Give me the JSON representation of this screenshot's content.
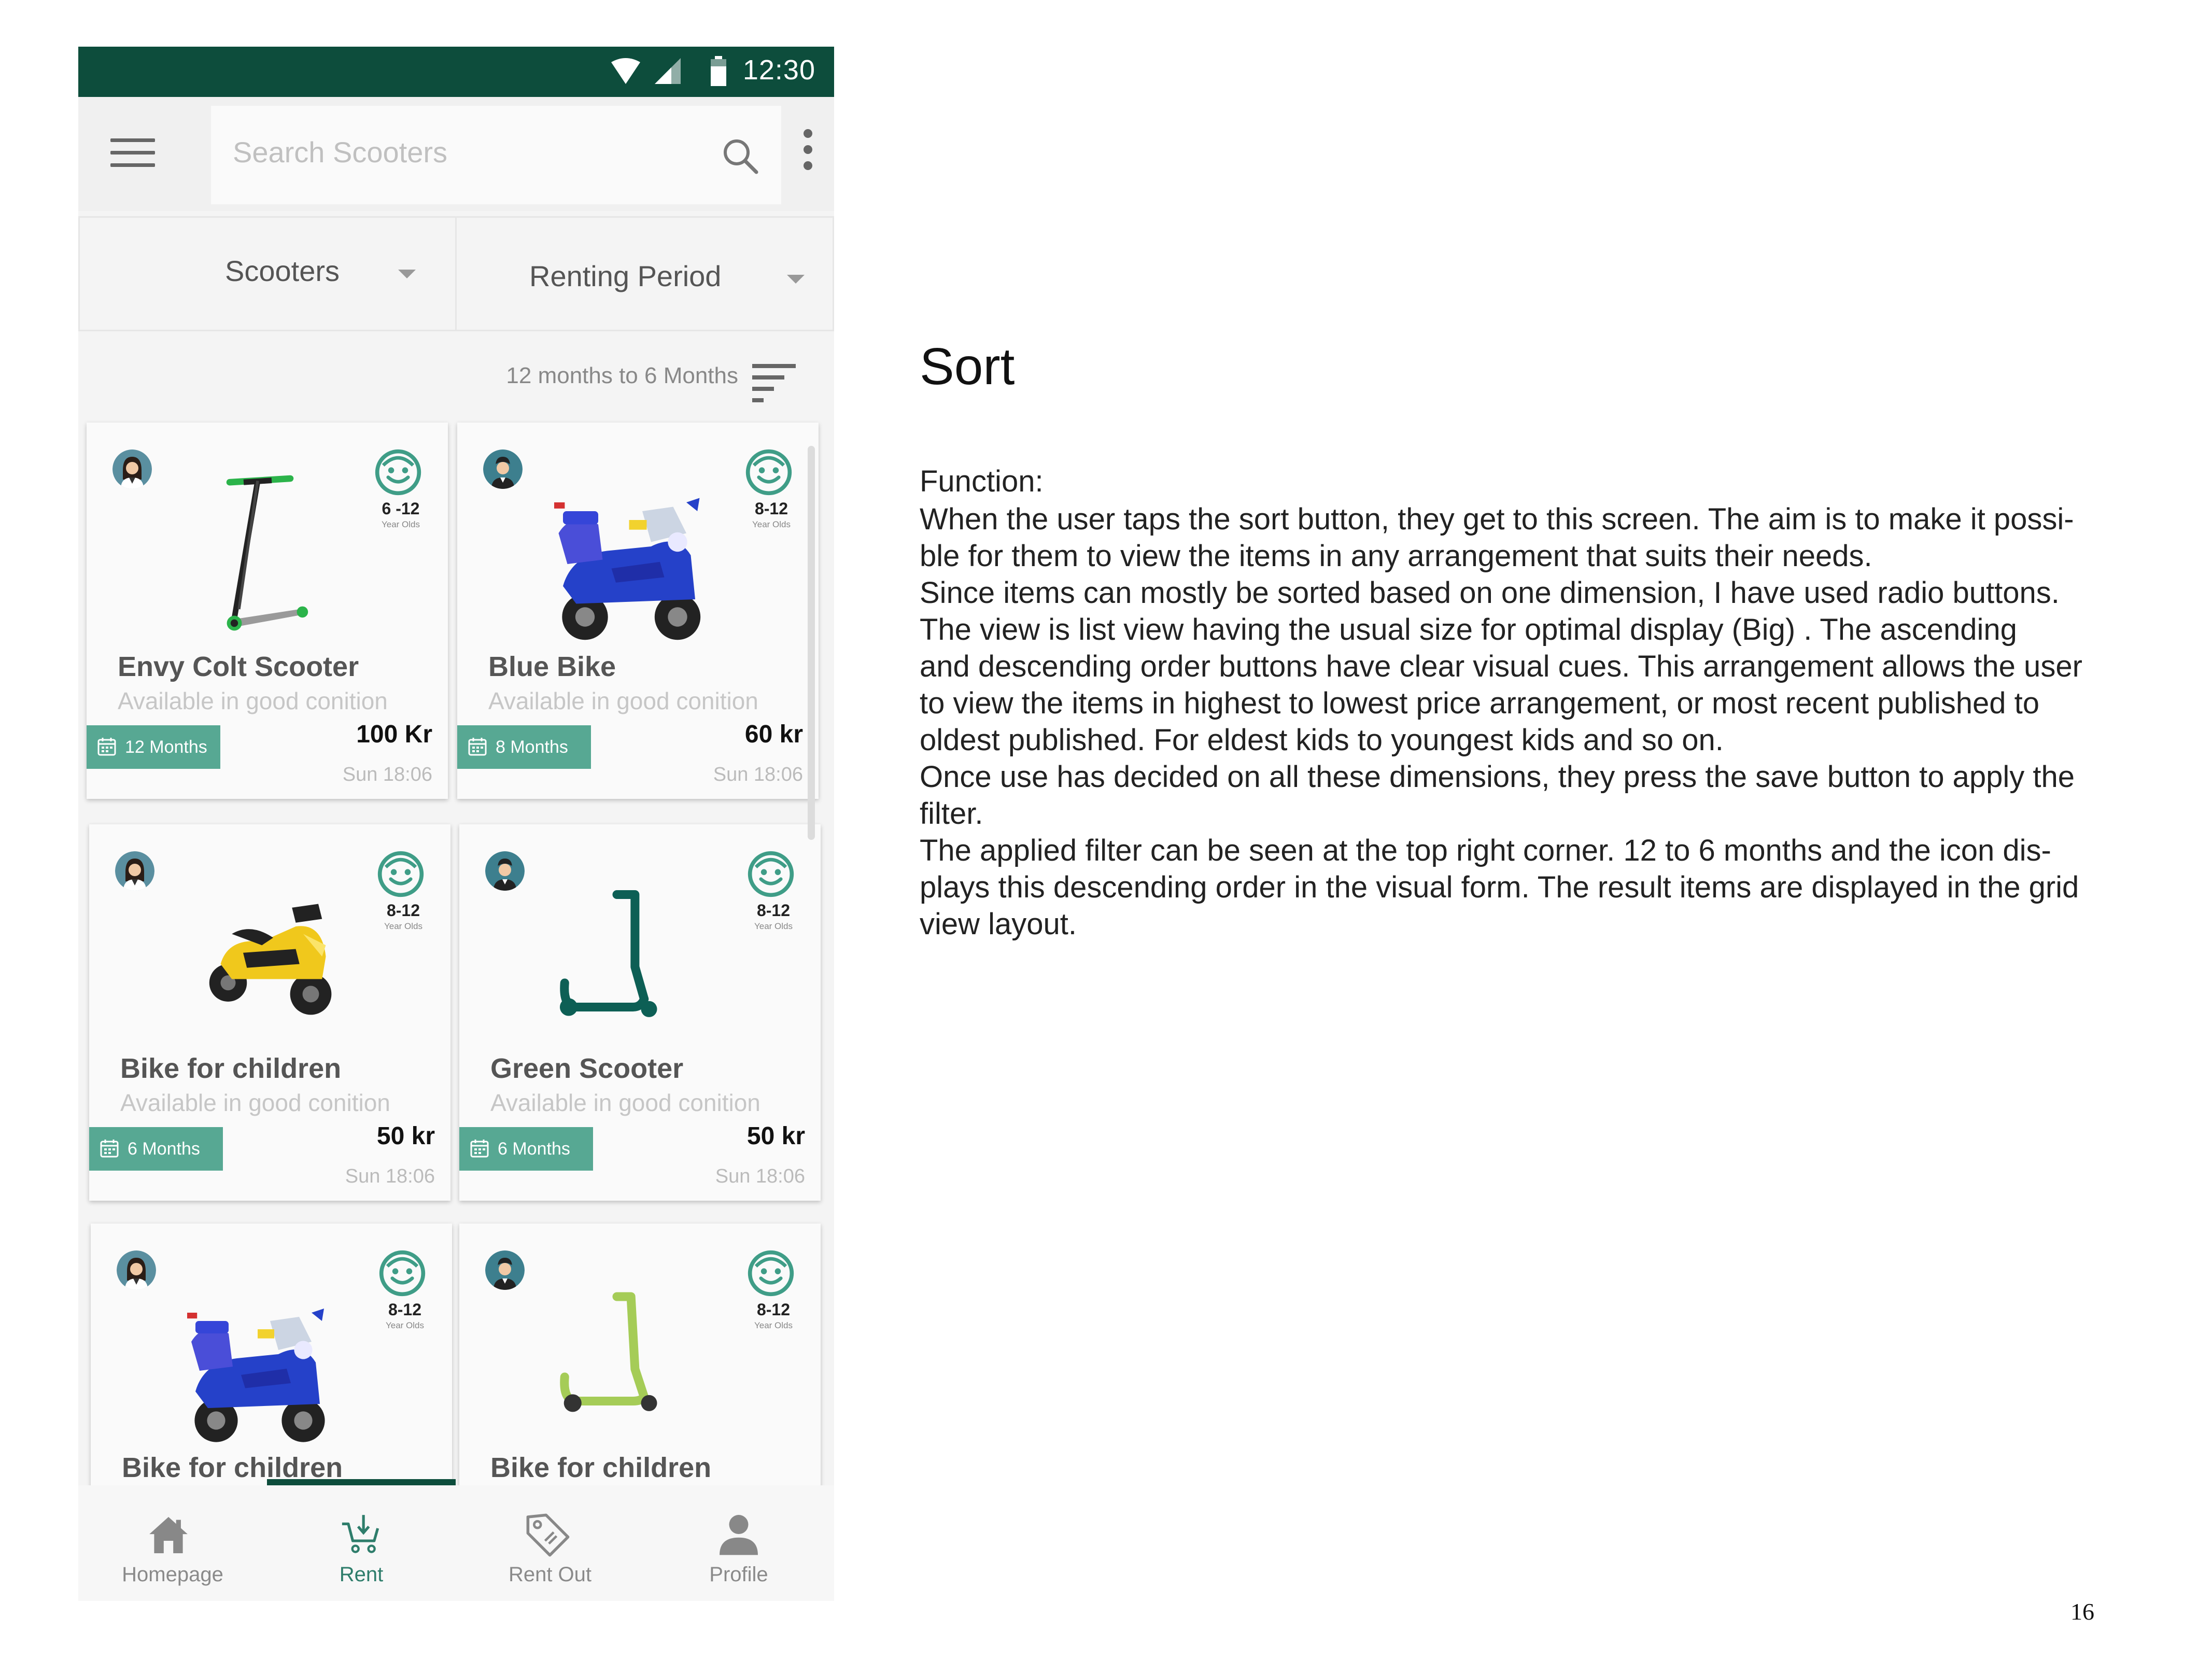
{
  "app": {
    "statusbar": {
      "time": "12:30",
      "wifi_icon": "wifi-icon",
      "signal_icon": "signal-icon",
      "battery_icon": "battery-icon"
    },
    "search": {
      "placeholder": "Search Scooters",
      "value": ""
    },
    "filters": {
      "category": "Scooters",
      "period": "Renting Period"
    },
    "sort": {
      "label": "12 months to 6 Months",
      "icon": "sort-descending-icon"
    },
    "colors": {
      "brand_dark": "#0d4d3c",
      "accent": "#57a893",
      "nav_active": "#2e7d6b"
    },
    "items": [
      {
        "title": "Envy Colt Scooter",
        "desc": "Available in good conition",
        "period": "12 Months",
        "price": "100 Kr",
        "when": "Sun 18:06",
        "age_range": "6 -12",
        "age_sub": "Year Olds",
        "image": "kick-scooter-image"
      },
      {
        "title": "Blue Bike",
        "desc": "Available in good conition",
        "period": "8 Months",
        "price": "60 kr",
        "when": "Sun 18:06",
        "age_range": "8-12",
        "age_sub": "Year Olds",
        "image": "blue-motorbike-image"
      },
      {
        "title": "Bike for children",
        "desc": "Available in good conition",
        "period": "6 Months",
        "price": "50 kr",
        "when": "Sun 18:06",
        "age_range": "8-12",
        "age_sub": "Year Olds",
        "image": "yellow-motorbike-image"
      },
      {
        "title": "Green Scooter",
        "desc": "Available in good conition",
        "period": "6 Months",
        "price": "50 kr",
        "when": "Sun 18:06",
        "age_range": "8-12",
        "age_sub": "Year Olds",
        "image": "green-scooter-image"
      },
      {
        "title": "Bike for children",
        "age_range": "8-12",
        "age_sub": "Year Olds",
        "image": "blue-motorbike-image"
      },
      {
        "title": "Bike for children",
        "age_range": "8-12",
        "age_sub": "Year Olds",
        "image": "light-green-scooter-image"
      }
    ],
    "nav": [
      {
        "label": "Homepage",
        "icon": "home-icon"
      },
      {
        "label": "Rent",
        "icon": "cart-icon"
      },
      {
        "label": "Rent Out",
        "icon": "tag-icon"
      },
      {
        "label": "Profile",
        "icon": "person-icon"
      }
    ]
  },
  "doc": {
    "title": "Sort",
    "label": "Function:",
    "body": [
      "When the user taps the sort button, they get to this screen. The aim is to make it possi-",
      "ble for them to view the items in any arrangement that suits their needs.",
      "Since items can mostly be sorted based on one dimension, I have used radio buttons.",
      "The view is  list view having the usual size for optimal display  (Big) . The ascending",
      "and descending order buttons have clear visual cues. This arrangement allows the user",
      "to view the items in highest to lowest price arrangement, or most recent published to",
      "oldest published. For eldest kids to youngest kids and so on.",
      "Once use has decided on all these dimensions, they press the save button to apply the",
      "filter.",
      "The applied filter can be seen at the top right corner. 12 to 6 months and the icon dis-",
      "plays this descending order in the visual form. The result items are displayed in the grid",
      "view layout."
    ],
    "page_number": "16"
  }
}
